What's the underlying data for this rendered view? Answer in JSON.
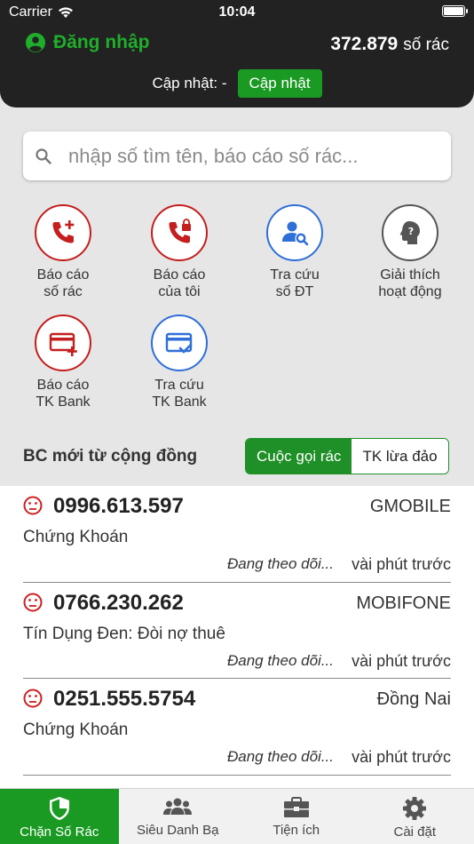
{
  "status_bar": {
    "carrier": "Carrier",
    "time": "10:04"
  },
  "header": {
    "login_label": "Đăng nhập",
    "count_value": "372.879",
    "count_unit": "số rác",
    "update_label": "Cập nhật: -",
    "update_button": "Cập nhật"
  },
  "search": {
    "placeholder": "nhập số tìm tên, báo cáo số rác..."
  },
  "actions": [
    {
      "line1": "Báo cáo",
      "line2": "số rác",
      "icon": "phone-add-icon"
    },
    {
      "line1": "Báo cáo",
      "line2": "của tôi",
      "icon": "phone-lock-icon"
    },
    {
      "line1": "Tra cứu",
      "line2": "số ĐT",
      "icon": "person-search-icon"
    },
    {
      "line1": "Giải thích",
      "line2": "hoạt động",
      "icon": "head-question-icon"
    },
    {
      "line1": "Báo cáo",
      "line2": "TK Bank",
      "icon": "card-add-icon"
    },
    {
      "line1": "Tra cứu",
      "line2": "TK Bank",
      "icon": "card-check-icon"
    }
  ],
  "community": {
    "title": "BC mới từ cộng đồng",
    "toggle": [
      "Cuộc gọi rác",
      "TK lừa đảo"
    ]
  },
  "reports": [
    {
      "phone": "0996.613.597",
      "carrier": "GMOBILE",
      "category": "Chứng Khoán",
      "status": "Đang theo dõi...",
      "time": "vài phút trước"
    },
    {
      "phone": "0766.230.262",
      "carrier": "MOBIFONE",
      "category": "Tín Dụng Đen: Đòi nợ thuê",
      "status": "Đang theo dõi...",
      "time": "vài phút trước"
    },
    {
      "phone": "0251.555.5754",
      "carrier": "Đồng Nai",
      "category": "Chứng Khoán",
      "status": "Đang theo dõi...",
      "time": "vài phút trước"
    }
  ],
  "tabs": [
    {
      "label": "Chặn Số Rác",
      "icon": "shield-icon",
      "active": true
    },
    {
      "label": "Siêu Danh Bạ",
      "icon": "people-icon",
      "active": false
    },
    {
      "label": "Tiện ích",
      "icon": "toolbox-icon",
      "active": false
    },
    {
      "label": "Cài đặt",
      "icon": "gear-icon",
      "active": false
    }
  ],
  "colors": {
    "green": "#1a9a22",
    "red": "#c41e1e",
    "blue": "#2e6fd8",
    "dark": "#222222"
  }
}
